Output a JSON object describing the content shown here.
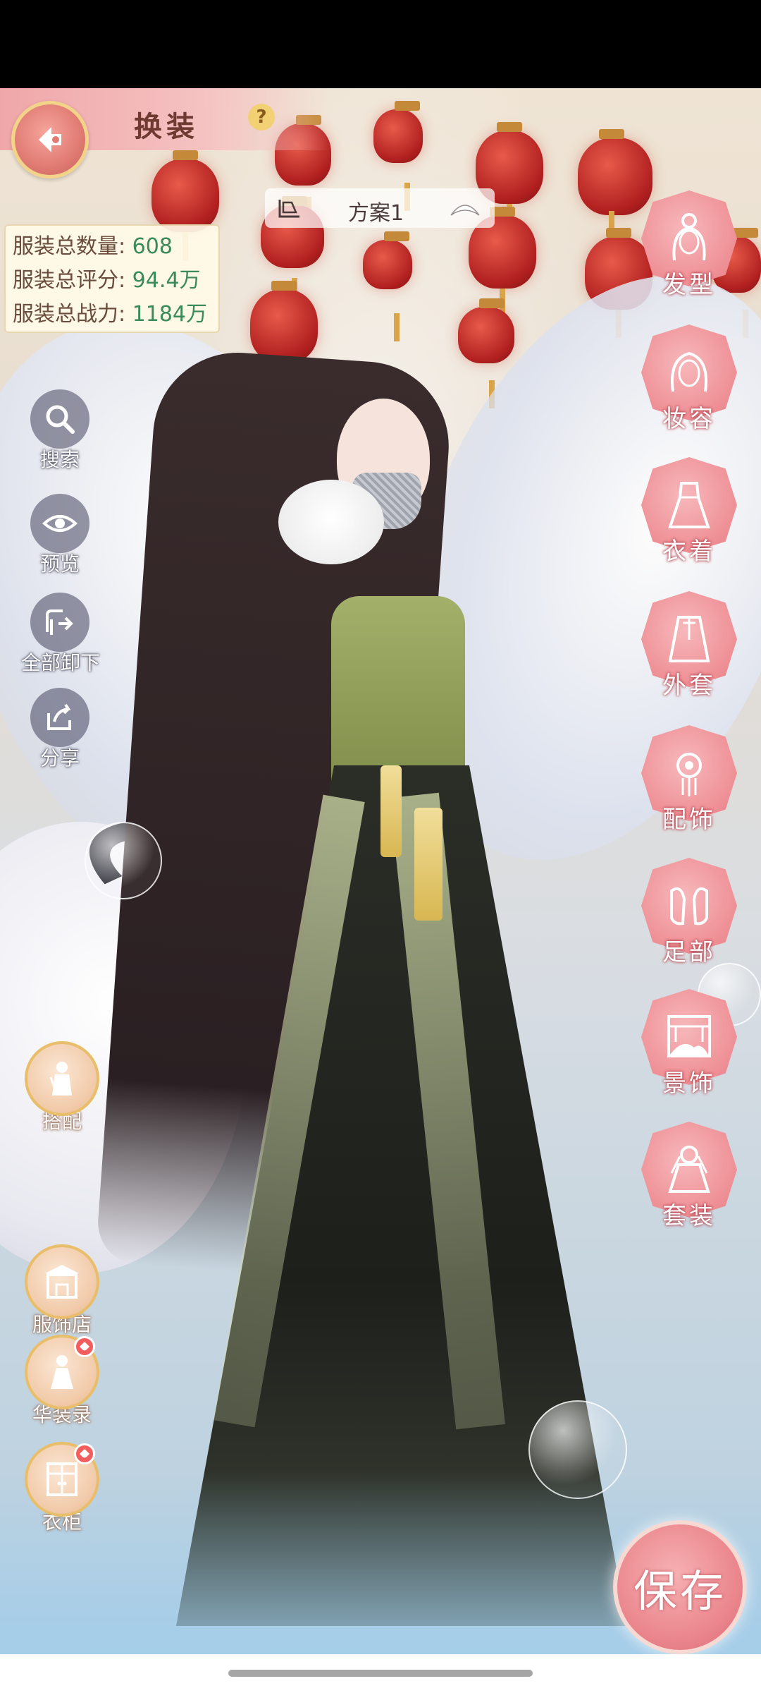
{
  "header": {
    "title": "换装",
    "help": "?"
  },
  "scheme": {
    "label": "方案1"
  },
  "stats": [
    {
      "label": "服装总数量:",
      "value": "608"
    },
    {
      "label": "服装总评分:",
      "value": "94.4万"
    },
    {
      "label": "服装总战力:",
      "value": "1184万"
    }
  ],
  "tools": [
    {
      "label": "搜索",
      "icon": "search-icon"
    },
    {
      "label": "预览",
      "icon": "eye-icon"
    },
    {
      "label": "全部卸下",
      "icon": "unequip-all-icon"
    },
    {
      "label": "分享",
      "icon": "share-icon"
    }
  ],
  "features": [
    {
      "label": "搭配",
      "icon": "outfit-match-icon",
      "notify": false
    },
    {
      "label": "服饰店",
      "icon": "shop-icon",
      "notify": false
    },
    {
      "label": "华装录",
      "icon": "gown-record-icon",
      "notify": true
    },
    {
      "label": "衣柜",
      "icon": "wardrobe-icon",
      "notify": true
    }
  ],
  "categories": [
    {
      "label": "发型",
      "icon": "hairstyle-icon"
    },
    {
      "label": "妆容",
      "icon": "makeup-icon"
    },
    {
      "label": "衣着",
      "icon": "clothing-icon"
    },
    {
      "label": "外套",
      "icon": "coat-icon"
    },
    {
      "label": "配饰",
      "icon": "accessory-icon"
    },
    {
      "label": "足部",
      "icon": "shoes-icon"
    },
    {
      "label": "景饰",
      "icon": "scene-decor-icon"
    },
    {
      "label": "套装",
      "icon": "suit-icon"
    }
  ],
  "save": {
    "label": "保存"
  },
  "colors": {
    "accent_pink": "#ee8f95",
    "stat_green": "#3a8a5a",
    "header_pink": "#f0a7a9"
  }
}
